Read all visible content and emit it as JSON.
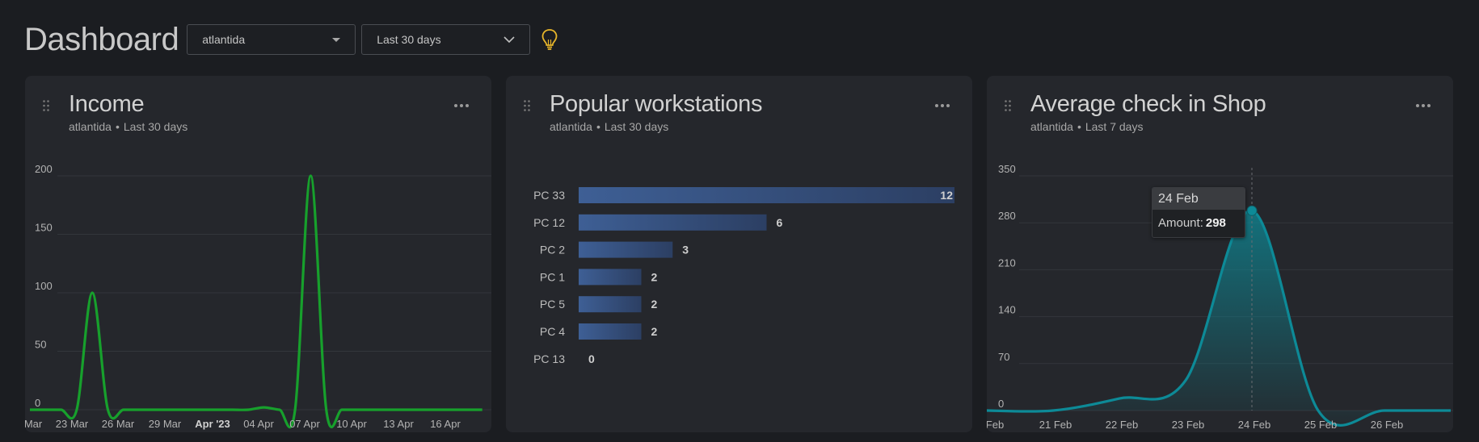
{
  "header": {
    "title": "Dashboard",
    "location_select": "atlantida",
    "period_select": "Last 30 days"
  },
  "cards": [
    {
      "title": "Income",
      "location": "atlantida",
      "period": "Last 30 days"
    },
    {
      "title": "Popular workstations",
      "location": "atlantida",
      "period": "Last 30 days"
    },
    {
      "title": "Average check in Shop",
      "location": "atlantida",
      "period": "Last 7 days"
    }
  ],
  "tooltip": {
    "date": "24 Feb",
    "label": "Amount:",
    "value": "298"
  },
  "colors": {
    "income_line": "#17a02c",
    "bars": "#3e5f95",
    "check_line": "#0d8a97",
    "accent_bulb": "#e8b62a"
  },
  "chart_data": [
    {
      "type": "line",
      "title": "Income",
      "ylim": [
        0,
        200
      ],
      "yticks": [
        "0",
        "50",
        "100",
        "150",
        "200"
      ],
      "xticks": [
        {
          "label": "Mar",
          "bold": false
        },
        {
          "label": "23 Mar",
          "bold": false
        },
        {
          "label": "26 Mar",
          "bold": false
        },
        {
          "label": "29 Mar",
          "bold": false
        },
        {
          "label": "Apr '23",
          "bold": true
        },
        {
          "label": "04 Apr",
          "bold": false
        },
        {
          "label": "07 Apr",
          "bold": false
        },
        {
          "label": "10 Apr",
          "bold": false
        },
        {
          "label": "13 Apr",
          "bold": false
        },
        {
          "label": "16 Apr",
          "bold": false
        }
      ],
      "series": [
        {
          "x": [
            "20 Mar",
            "21 Mar",
            "22 Mar",
            "23 Mar",
            "24 Mar",
            "25 Mar",
            "26 Mar",
            "27 Mar",
            "28 Mar",
            "29 Mar",
            "30 Mar",
            "31 Mar",
            "01 Apr",
            "02 Apr",
            "03 Apr",
            "04 Apr",
            "05 Apr",
            "06 Apr",
            "07 Apr",
            "08 Apr",
            "09 Apr",
            "10 Apr",
            "11 Apr",
            "12 Apr",
            "13 Apr",
            "14 Apr",
            "15 Apr",
            "16 Apr",
            "17 Apr",
            "18 Apr"
          ],
          "values": [
            0,
            0,
            0,
            0,
            100,
            0,
            0,
            0,
            0,
            0,
            0,
            0,
            0,
            0,
            0,
            2,
            0,
            0,
            200,
            0,
            0,
            0,
            0,
            0,
            0,
            0,
            0,
            0,
            0,
            0
          ]
        }
      ]
    },
    {
      "type": "bar",
      "title": "Popular workstations",
      "categories": [
        "PC 33",
        "PC 12",
        "PC 2",
        "PC 1",
        "PC 5",
        "PC 4",
        "PC 13"
      ],
      "values": [
        12,
        6,
        3,
        2,
        2,
        2,
        0
      ]
    },
    {
      "type": "area",
      "title": "Average check in Shop",
      "ylim": [
        0,
        350
      ],
      "yticks": [
        "0",
        "70",
        "140",
        "210",
        "280",
        "350"
      ],
      "xticks": [
        "Feb",
        "21 Feb",
        "22 Feb",
        "23 Feb",
        "24 Feb",
        "25 Feb",
        "26 Feb"
      ],
      "series": [
        {
          "x": [
            "20 Feb",
            "21 Feb",
            "22 Feb",
            "23 Feb",
            "24 Feb",
            "25 Feb",
            "26 Feb",
            "27 Feb"
          ],
          "values": [
            0,
            0,
            18,
            45,
            298,
            0,
            0,
            0
          ]
        }
      ]
    }
  ]
}
